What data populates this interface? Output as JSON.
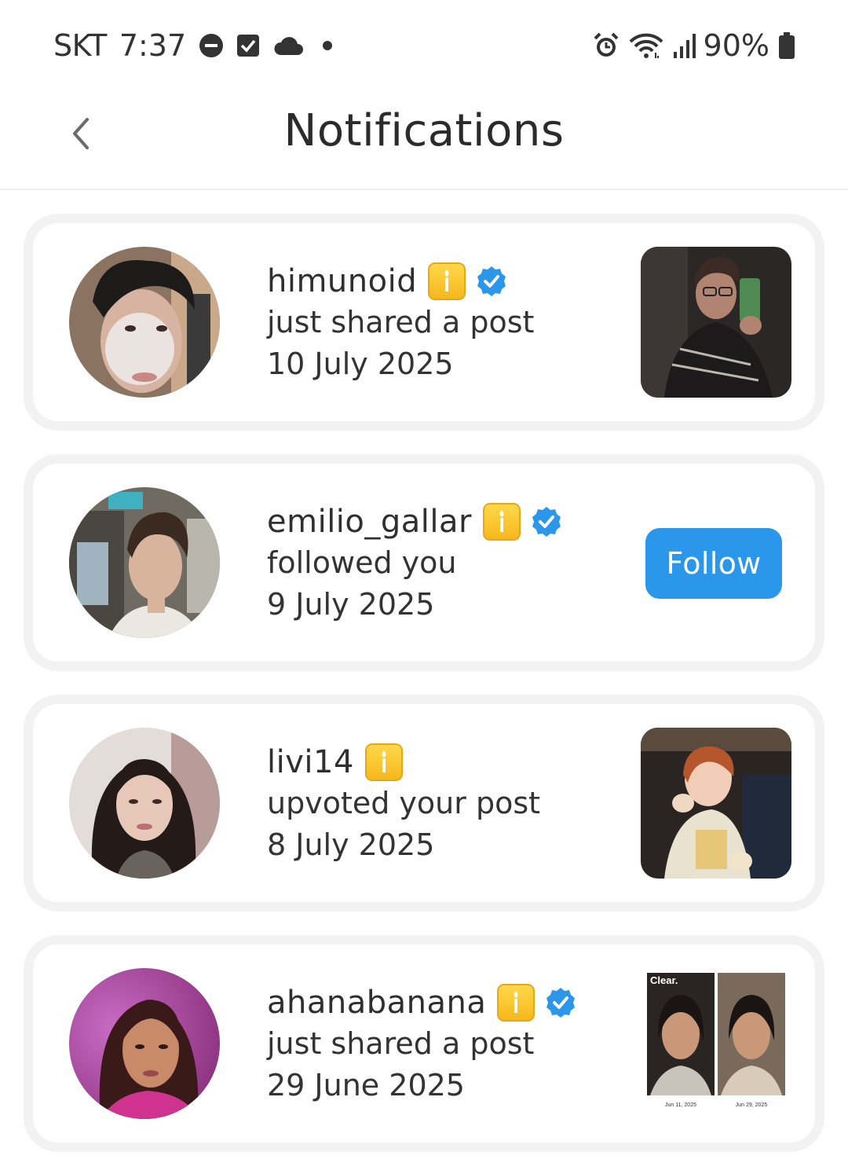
{
  "status_bar": {
    "carrier": "SKT",
    "time": "7:37",
    "battery": "90%",
    "icons": [
      "do-not-disturb-icon",
      "checkbox-icon",
      "cloud-icon",
      "dot-icon",
      "alarm-icon",
      "wifi-icon",
      "signal-icon",
      "battery-icon"
    ]
  },
  "header": {
    "title": "Notifications",
    "back_icon": "chevron-left-icon"
  },
  "notifications": [
    {
      "username": "himunoid",
      "candle_badge": true,
      "verified": true,
      "action": "just shared a post",
      "date": "10 July 2025",
      "trailing": "post-thumbnail"
    },
    {
      "username": "emilio_gallar",
      "candle_badge": true,
      "verified": true,
      "action": "followed you",
      "date": "9 July 2025",
      "trailing": "follow-button",
      "follow_label": "Follow"
    },
    {
      "username": "livi14",
      "candle_badge": true,
      "verified": false,
      "action": "upvoted your post",
      "date": "8 July 2025",
      "trailing": "post-thumbnail"
    },
    {
      "username": "ahanabanana",
      "candle_badge": true,
      "verified": true,
      "action": "just shared a post",
      "date": "29 June 2025",
      "trailing": "post-thumbnail",
      "thumb_text": {
        "brand": "Clear.",
        "left_caption": "Jun 11, 2025",
        "right_caption": "Jun 29, 2025"
      }
    }
  ],
  "colors": {
    "accent": "#2a97ea",
    "verified": "#2a97ea",
    "badge": "#f6b81c",
    "card_border": "#f2f2f2"
  }
}
